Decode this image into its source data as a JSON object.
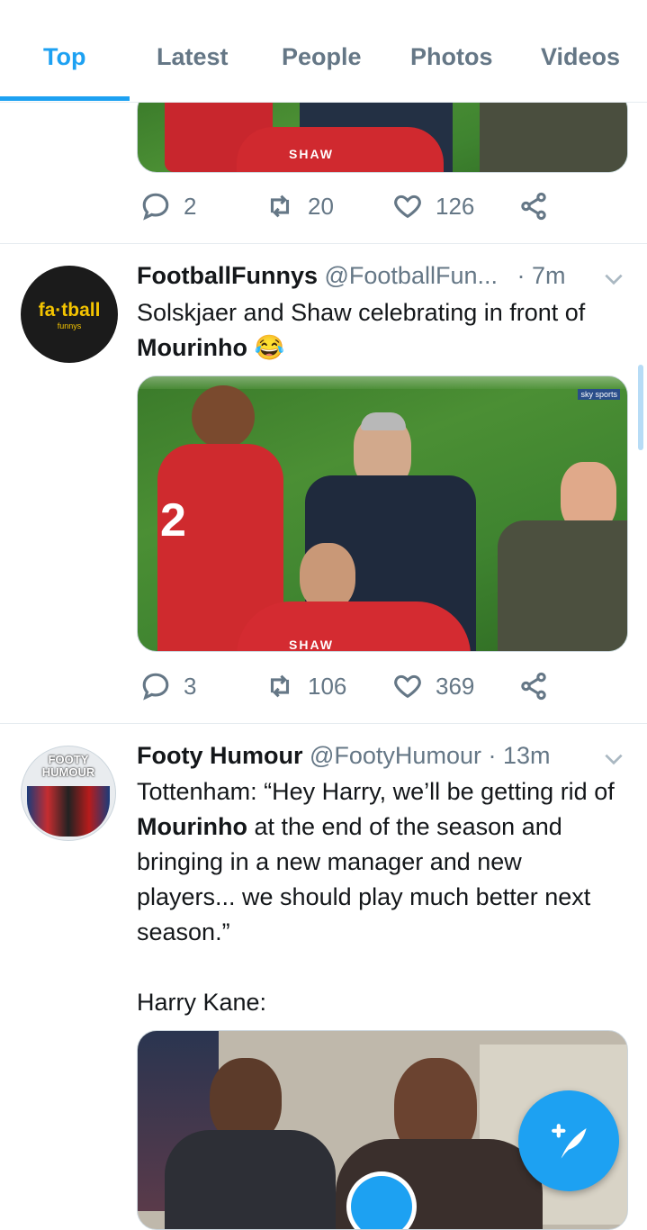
{
  "tabs": [
    {
      "label": "Top",
      "active": true
    },
    {
      "label": "Latest"
    },
    {
      "label": "People"
    },
    {
      "label": "Photos"
    },
    {
      "label": "Videos"
    }
  ],
  "tweet0": {
    "media_label": "SHAW",
    "replies": "2",
    "retweets": "20",
    "likes": "126"
  },
  "tweet1": {
    "avatar_text": "fa·tball",
    "avatar_sub": "funnys",
    "name": "FootballFunnys",
    "handle": "@FootballFun...",
    "time": "· 7m",
    "text_part1": "Solskjaer and Shaw celebrating in front of ",
    "text_bold": "Mourinho",
    "emoji": "😂",
    "media_label": "SHAW",
    "media_watermark": "sky sports",
    "replies": "3",
    "retweets": "106",
    "likes": "369"
  },
  "tweet2": {
    "avatar_text": "FOOTY HUMOUR",
    "name": "Footy Humour",
    "handle": "@FootyHumour",
    "time": "· 13m",
    "text_part1": "Tottenham: “Hey Harry, we’ll be getting rid of ",
    "text_bold": "Mourinho",
    "text_part2": " at the end of the season and bringing in a new manager and new players... we should play much better next season.”",
    "text_part3": "Harry Kane:"
  },
  "colors": {
    "accent": "#1da1f2",
    "secondary_text": "#657786",
    "divider": "#e6ecf0"
  },
  "icons": [
    "reply-icon",
    "retweet-icon",
    "like-icon",
    "share-icon",
    "chevron-down-icon",
    "compose-icon",
    "play-icon"
  ]
}
